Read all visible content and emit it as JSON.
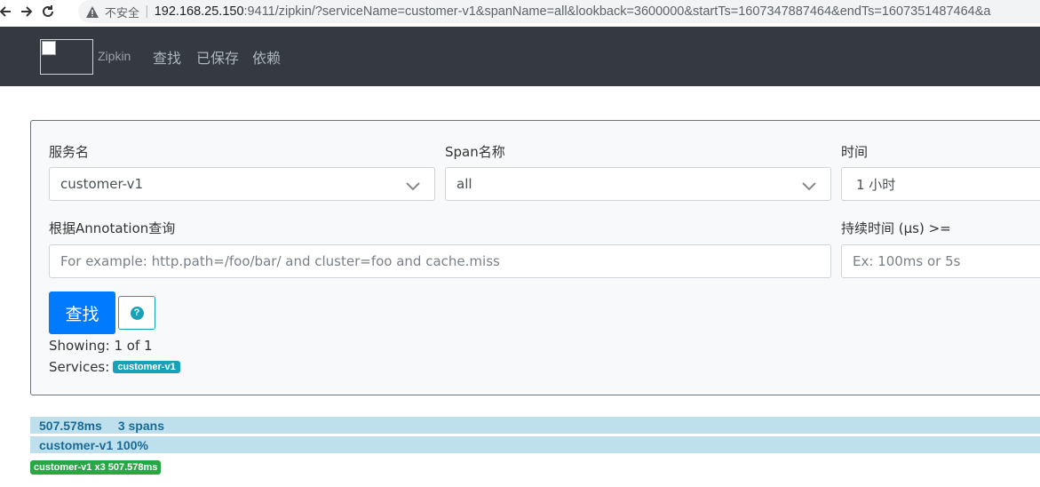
{
  "browser": {
    "back_icon": "back-arrow-icon",
    "forward_icon": "forward-arrow-icon",
    "reload_icon": "reload-icon",
    "insecure_label": "不安全",
    "url_host": "192.168.25.150",
    "url_rest": ":9411/zipkin/?serviceName=customer-v1&spanName=all&lookback=3600000&startTs=1607347887464&endTs=1607351487464&a"
  },
  "navbar": {
    "brand": "Zipkin",
    "links": [
      "查找",
      "已保存",
      "依赖"
    ]
  },
  "search": {
    "service_label": "服务名",
    "service_value": "customer-v1",
    "span_label": "Span名称",
    "span_value": "all",
    "time_label": "时间",
    "time_value": "1 小时",
    "annotation_label": "根据Annotation查询",
    "annotation_placeholder": "For example: http.path=/foo/bar/ and cluster=foo and cache.miss",
    "duration_label": "持续时间 (μs) >=",
    "duration_placeholder": "Ex: 100ms or 5s",
    "find_button": "查找",
    "help_icon": "question-circle-icon",
    "showing": "Showing: 1 of 1",
    "services_label": "Services:",
    "services_badge": "customer-v1"
  },
  "results": {
    "duration": "507.578ms",
    "spans": "3 spans",
    "service_summary": "customer-v1 100%",
    "service_badge": "customer-v1 x3 507.578ms"
  },
  "colors": {
    "navbar_bg": "#343a40",
    "primary": "#007bff",
    "info": "#17a2b8",
    "success": "#28a745",
    "trace_bar": "#bee0ec"
  }
}
